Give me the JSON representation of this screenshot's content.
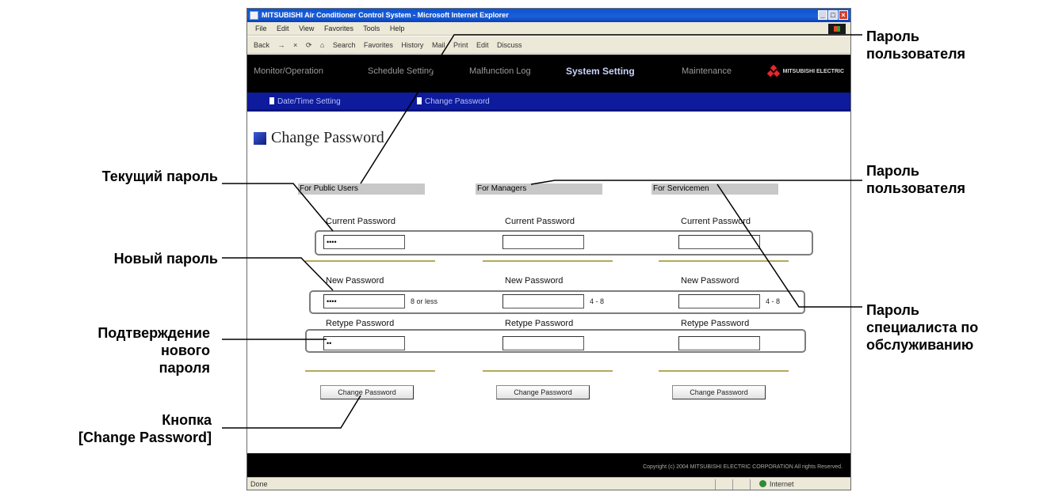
{
  "window": {
    "title": "MITSUBISHI Air Conditioner Control System - Microsoft Internet Explorer",
    "menu": [
      "File",
      "Edit",
      "View",
      "Favorites",
      "Tools",
      "Help"
    ],
    "toolbar": [
      "Back",
      "→",
      "×",
      "⟳",
      "⌂",
      "Search",
      "Favorites",
      "History",
      "Mail",
      "Print",
      "Edit",
      "Discuss"
    ]
  },
  "app": {
    "nav": [
      "Monitor/Operation",
      "Schedule Setting",
      "Malfunction Log",
      "System Setting",
      "Maintenance"
    ],
    "active_nav": "System Setting",
    "brand": "MITSUBISHI ELECTRIC",
    "subnav": [
      "Date/Time Setting",
      "Change Password"
    ],
    "page_title": "Change Password",
    "columns": [
      {
        "header": "For Public Users",
        "current_label": "Current Password",
        "current_value": "••••",
        "new_label": "New Password",
        "new_value": "••••",
        "new_hint": "8 or less",
        "retype_label": "Retype Password",
        "retype_value": "••",
        "button": "Change Password"
      },
      {
        "header": "For Managers",
        "current_label": "Current Password",
        "current_value": "",
        "new_label": "New Password",
        "new_value": "",
        "new_hint": "4 - 8",
        "retype_label": "Retype Password",
        "retype_value": "",
        "button": "Change Password"
      },
      {
        "header": "For Servicemen",
        "current_label": "Current Password",
        "current_value": "",
        "new_label": "New Password",
        "new_value": "",
        "new_hint": "4 - 8",
        "retype_label": "Retype Password",
        "retype_value": "",
        "button": "Change Password"
      }
    ],
    "footer": "Copyright (c) 2004 MITSUBISHI ELECTRIC CORPORATION All rights Reserved.",
    "status_left": "Done",
    "status_zone": "Internet"
  },
  "callouts": {
    "current_password": "Текущий пароль",
    "new_password": "Новый пароль",
    "confirm_line1": "Подтверждение",
    "confirm_line2": "нового",
    "confirm_line3": "пароля",
    "button_line1": "Кнопка",
    "button_line2": "[Change Password]",
    "user_pw_top_line1": "Пароль",
    "user_pw_top_line2": "пользователя",
    "user_pw_mid_line1": "Пароль",
    "user_pw_mid_line2": "пользователя",
    "service_line1": "Пароль",
    "service_line2": "специалиста по",
    "service_line3": "обслуживанию"
  }
}
